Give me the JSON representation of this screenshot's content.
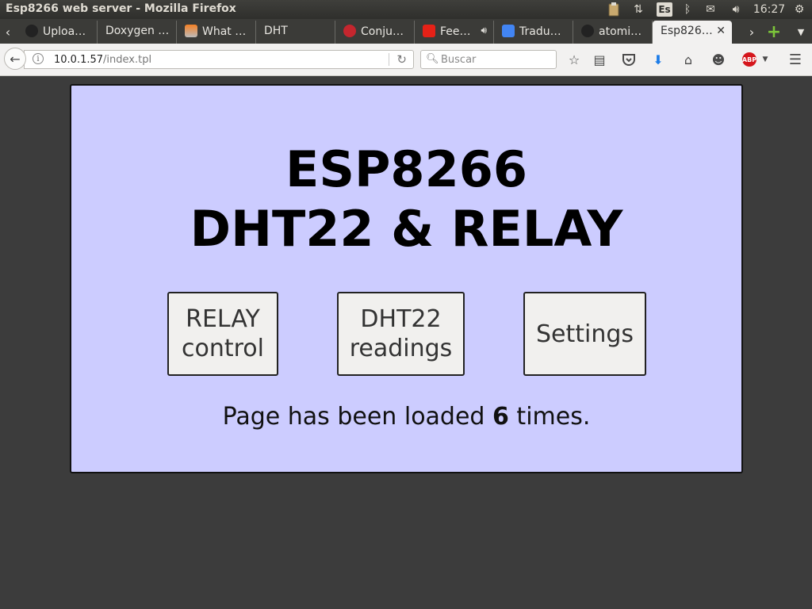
{
  "window": {
    "title": "Esp8266 web server - Mozilla Firefox"
  },
  "tray": {
    "keyboard_layout": "Es",
    "clock": "16:27"
  },
  "tabs": [
    {
      "label": "Uploa…",
      "icon": "github-icon"
    },
    {
      "label": "Doxygen …",
      "icon": ""
    },
    {
      "label": "What …",
      "icon": "stackoverflow-icon"
    },
    {
      "label": "DHT",
      "icon": ""
    },
    {
      "label": "Conju…",
      "icon": "red-app-icon"
    },
    {
      "label": "Fee…",
      "icon": "youtube-icon"
    },
    {
      "label": "Tradu…",
      "icon": "google-translate-icon"
    },
    {
      "label": "atomi…",
      "icon": "github-icon"
    },
    {
      "label": "Esp826…",
      "icon": "",
      "active": true
    }
  ],
  "nav": {
    "url_host": "10.0.1.57",
    "url_path": "/index.tpl",
    "search_placeholder": "Buscar"
  },
  "page": {
    "heading_line1": "ESP8266",
    "heading_line2": "DHT22 & RELAY",
    "buttons": [
      {
        "label": "RELAY\ncontrol"
      },
      {
        "label": "DHT22\nreadings"
      },
      {
        "label": "Settings"
      }
    ],
    "counter_prefix": "Page has been loaded ",
    "counter_value": "6",
    "counter_suffix": " times."
  },
  "colors": {
    "page_background": "#3c3c3c",
    "card_background": "#ccccff",
    "button_background": "#f1f0ee"
  }
}
